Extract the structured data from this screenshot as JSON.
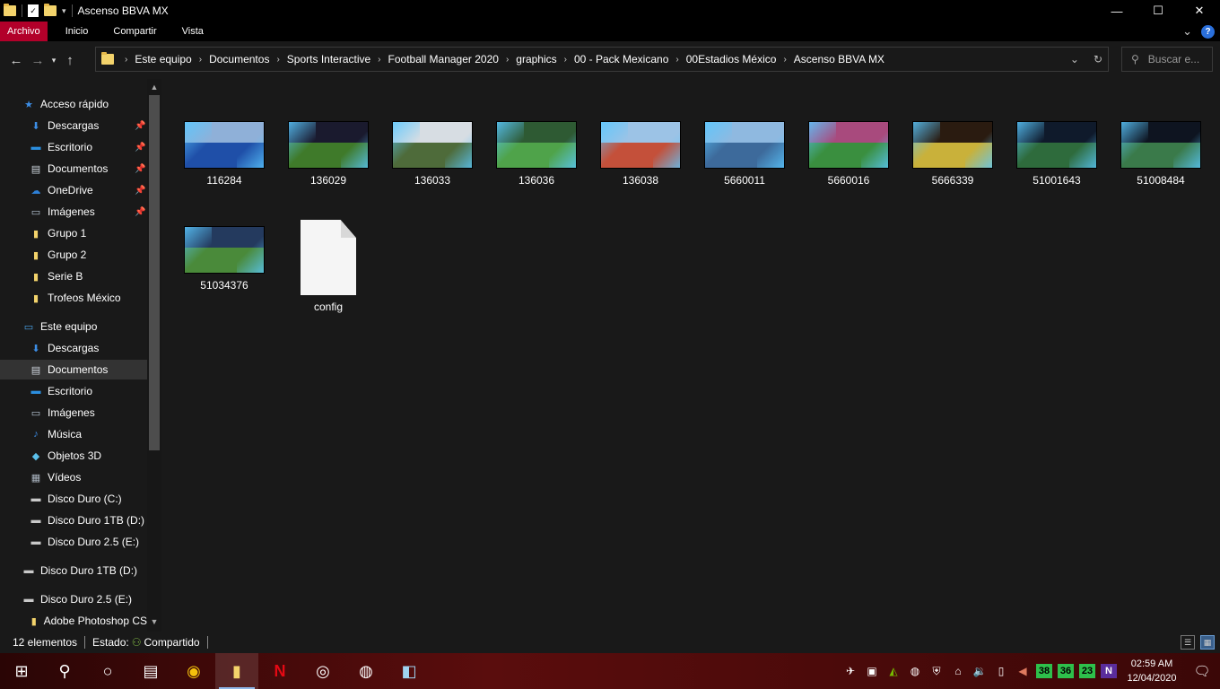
{
  "window": {
    "title": "Ascenso BBVA MX",
    "controls": {
      "minimize": "—",
      "maximize": "☐",
      "close": "✕"
    }
  },
  "ribbon": {
    "file": "Archivo",
    "tabs": [
      "Inicio",
      "Compartir",
      "Vista"
    ],
    "help": "?",
    "collapse": "⌄"
  },
  "address": {
    "crumbs": [
      "Este equipo",
      "Documentos",
      "Sports Interactive",
      "Football Manager 2020",
      "graphics",
      "00 - Pack Mexicano",
      "00Estadios México",
      "Ascenso BBVA MX"
    ],
    "search_placeholder": "Buscar e..."
  },
  "nav": {
    "items": [
      {
        "label": "Acceso rápido",
        "icon": "star-icon",
        "glyph": "★",
        "color": "#3d8ee6",
        "indent": false
      },
      {
        "label": "Descargas",
        "icon": "download-icon",
        "glyph": "⬇",
        "color": "#3d8ee6",
        "indent": true,
        "pinned": true
      },
      {
        "label": "Escritorio",
        "icon": "desktop-icon",
        "glyph": "▬",
        "color": "#2b8fe0",
        "indent": true,
        "pinned": true
      },
      {
        "label": "Documentos",
        "icon": "documents-icon",
        "glyph": "▤",
        "color": "#cfd6de",
        "indent": true,
        "pinned": true
      },
      {
        "label": "OneDrive",
        "icon": "cloud-icon",
        "glyph": "☁",
        "color": "#2d7fd6",
        "indent": true,
        "pinned": true
      },
      {
        "label": "Imágenes",
        "icon": "pictures-icon",
        "glyph": "▭",
        "color": "#b8c7d6",
        "indent": true,
        "pinned": true
      },
      {
        "label": "Grupo 1",
        "icon": "folder-icon",
        "glyph": "▮",
        "color": "#f3d36b",
        "indent": true
      },
      {
        "label": "Grupo 2",
        "icon": "folder-icon",
        "glyph": "▮",
        "color": "#f3d36b",
        "indent": true
      },
      {
        "label": "Serie B",
        "icon": "folder-icon",
        "glyph": "▮",
        "color": "#f3d36b",
        "indent": true
      },
      {
        "label": "Trofeos México",
        "icon": "folder-icon",
        "glyph": "▮",
        "color": "#f3d36b",
        "indent": true
      },
      {
        "label": "Este equipo",
        "icon": "computer-icon",
        "glyph": "▭",
        "color": "#4aa3e8",
        "indent": false
      },
      {
        "label": "Descargas",
        "icon": "download-icon",
        "glyph": "⬇",
        "color": "#3d8ee6",
        "indent": true
      },
      {
        "label": "Documentos",
        "icon": "documents-icon",
        "glyph": "▤",
        "color": "#cfd6de",
        "indent": true,
        "selected": true
      },
      {
        "label": "Escritorio",
        "icon": "desktop-icon",
        "glyph": "▬",
        "color": "#2b8fe0",
        "indent": true
      },
      {
        "label": "Imágenes",
        "icon": "pictures-icon",
        "glyph": "▭",
        "color": "#b8c7d6",
        "indent": true
      },
      {
        "label": "Música",
        "icon": "music-icon",
        "glyph": "♪",
        "color": "#3d8ee6",
        "indent": true
      },
      {
        "label": "Objetos 3D",
        "icon": "cube-icon",
        "glyph": "◆",
        "color": "#5bc0eb",
        "indent": true
      },
      {
        "label": "Vídeos",
        "icon": "video-icon",
        "glyph": "▦",
        "color": "#aab4c0",
        "indent": true
      },
      {
        "label": "Disco Duro (C:)",
        "icon": "drive-icon",
        "glyph": "▬",
        "color": "#c9c9c9",
        "indent": true
      },
      {
        "label": "Disco Duro 1TB (D:)",
        "icon": "drive-icon",
        "glyph": "▬",
        "color": "#c9c9c9",
        "indent": true
      },
      {
        "label": "Disco Duro 2.5 (E:)",
        "icon": "drive-icon",
        "glyph": "▬",
        "color": "#c9c9c9",
        "indent": true
      },
      {
        "label": "Disco Duro 1TB (D:)",
        "icon": "drive-icon",
        "glyph": "▬",
        "color": "#c9c9c9",
        "indent": false
      },
      {
        "label": "Disco Duro 2.5 (E:)",
        "icon": "drive-icon",
        "glyph": "▬",
        "color": "#c9c9c9",
        "indent": false
      },
      {
        "label": "Adobe Photoshop CS",
        "icon": "folder-icon",
        "glyph": "▮",
        "color": "#f3d36b",
        "indent": true
      }
    ]
  },
  "files": [
    {
      "name": "116284",
      "sky": "#8fb0d8",
      "field": "#1f4fa8"
    },
    {
      "name": "136029",
      "sky": "#1a1a2e",
      "field": "#3f7a2a"
    },
    {
      "name": "136033",
      "sky": "#d7dde3",
      "field": "#4e6b3a"
    },
    {
      "name": "136036",
      "sky": "#2e5a33",
      "field": "#4fa34a"
    },
    {
      "name": "136038",
      "sky": "#9cc3e6",
      "field": "#c4503a"
    },
    {
      "name": "5660011",
      "sky": "#8fb9e0",
      "field": "#3d6a9b"
    },
    {
      "name": "5660016",
      "sky": "#a84a7d",
      "field": "#3a8f3f"
    },
    {
      "name": "5666339",
      "sky": "#2a1b10",
      "field": "#c9b13a"
    },
    {
      "name": "51001643",
      "sky": "#0f1a2b",
      "field": "#2e6b3c"
    },
    {
      "name": "51008484",
      "sky": "#0e1420",
      "field": "#3a7a4a"
    },
    {
      "name": "51034376",
      "sky": "#243a5e",
      "field": "#4a8a3a"
    },
    {
      "name": "config",
      "type": "document"
    }
  ],
  "status": {
    "count": "12 elementos",
    "state_label": "Estado:",
    "state_value": "Compartido"
  },
  "taskbar": {
    "apps": [
      {
        "name": "windows-start-icon",
        "glyph": "⊞"
      },
      {
        "name": "search-icon",
        "glyph": "⚲"
      },
      {
        "name": "cortana-icon",
        "glyph": "○"
      },
      {
        "name": "task-view-icon",
        "glyph": "▤"
      },
      {
        "name": "chrome-icon",
        "glyph": "◉"
      },
      {
        "name": "file-explorer-icon",
        "glyph": "▮",
        "active": true
      },
      {
        "name": "netflix-icon",
        "glyph": "N"
      },
      {
        "name": "obs-icon",
        "glyph": "◎"
      },
      {
        "name": "steam-icon",
        "glyph": "◍"
      },
      {
        "name": "app-icon",
        "glyph": "◧"
      }
    ],
    "tray_badges": [
      "38",
      "36",
      "23"
    ],
    "tray_n": "N",
    "time": "02:59 AM",
    "date": "12/04/2020"
  }
}
